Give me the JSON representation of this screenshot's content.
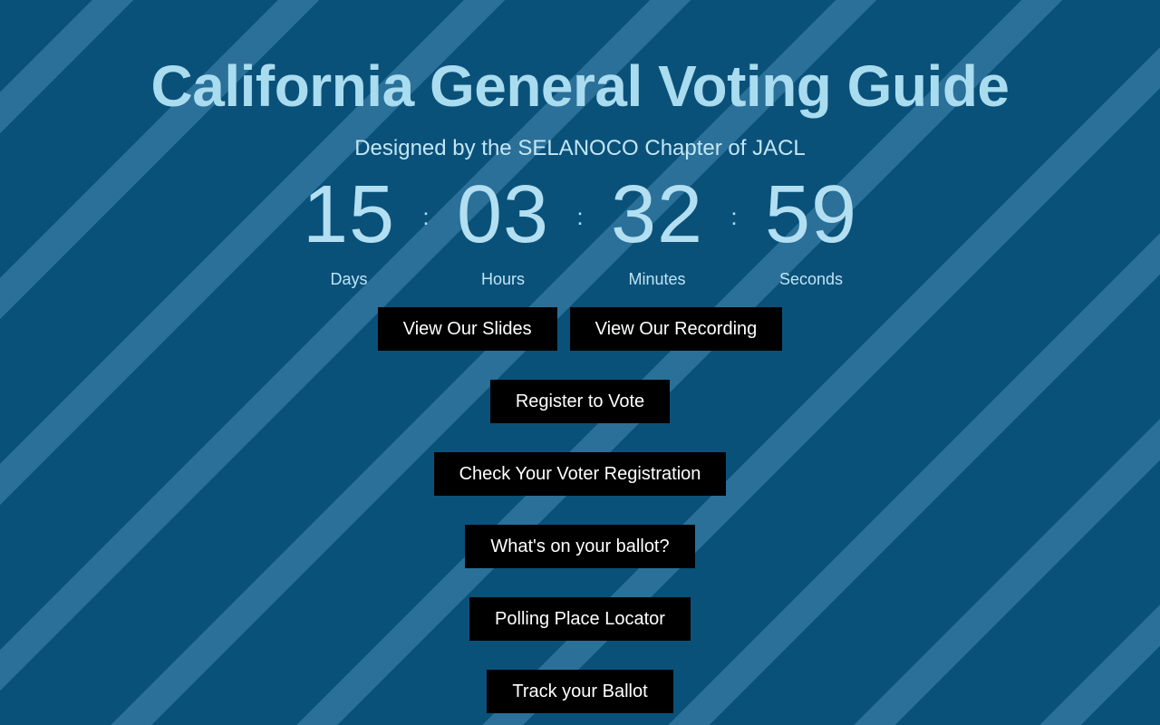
{
  "header": {
    "title": "California General Voting Guide",
    "subtitle": "Designed by the SELANOCO Chapter of JACL"
  },
  "countdown": {
    "separator": ":",
    "units": [
      {
        "value": "15",
        "label": "Days"
      },
      {
        "value": "03",
        "label": "Hours"
      },
      {
        "value": "32",
        "label": "Minutes"
      },
      {
        "value": "59",
        "label": "Seconds"
      }
    ]
  },
  "buttons": {
    "view_slides": "View Our Slides",
    "view_recording": "View Our Recording",
    "register_to_vote": "Register to Vote",
    "check_registration": "Check Your Voter Registration",
    "whats_on_ballot": "What's on your ballot?",
    "polling_place_locator": "Polling Place Locator",
    "track_your_ballot": "Track your Ballot"
  },
  "colors": {
    "background_dark_stripe": "#0a5179",
    "background_light_stripe": "#2a7099",
    "heading_text": "#aadcf0",
    "countdown_text": "#b3dff2",
    "button_background": "#000000",
    "button_text": "#ffffff"
  }
}
